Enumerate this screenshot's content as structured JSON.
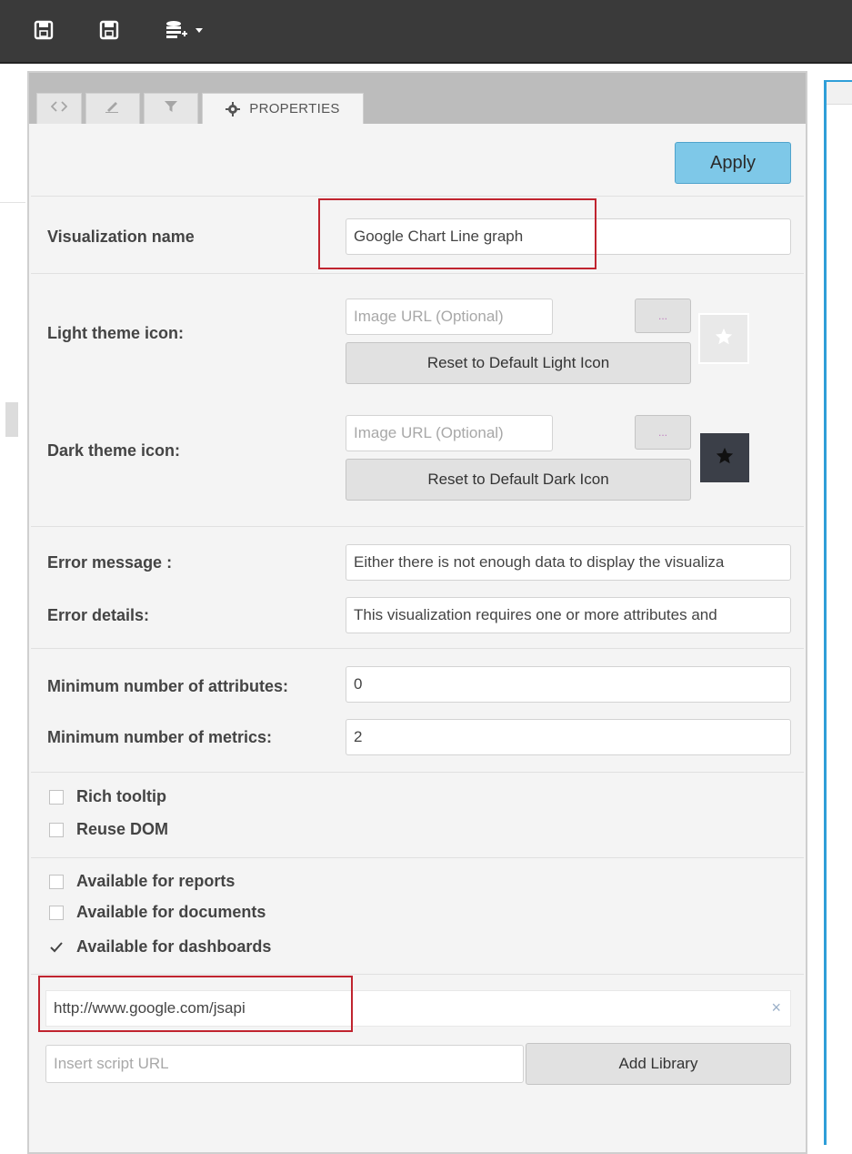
{
  "toolbar": {
    "items": [
      {
        "icon": "save-icon"
      },
      {
        "icon": "save-as-icon"
      },
      {
        "icon": "add-dataset-icon"
      }
    ]
  },
  "tabs": [
    {
      "icon": "code-icon",
      "label": ""
    },
    {
      "icon": "pencil-icon",
      "label": ""
    },
    {
      "icon": "filter-icon",
      "label": ""
    },
    {
      "icon": "gear-icon",
      "label": "PROPERTIES"
    }
  ],
  "apply_label": "Apply",
  "visualization": {
    "label": "Visualization name",
    "value": "Google Chart Line graph"
  },
  "light_icon": {
    "label": "Light theme icon:",
    "placeholder": "Image URL (Optional)",
    "browse_label": "...",
    "reset_label": "Reset to Default Light Icon"
  },
  "dark_icon": {
    "label": "Dark theme icon:",
    "placeholder": "Image URL (Optional)",
    "browse_label": "...",
    "reset_label": "Reset to Default Dark Icon"
  },
  "error_message": {
    "label": "Error message :",
    "value": "Either there is not enough data to display the visualiza"
  },
  "error_details": {
    "label": "Error details:",
    "value": "This visualization requires one or more attributes and"
  },
  "min_attributes": {
    "label": "Minimum number of attributes:",
    "value": "0"
  },
  "min_metrics": {
    "label": "Minimum number of metrics:",
    "value": "2"
  },
  "options": [
    {
      "label": "Rich tooltip",
      "checked": false
    },
    {
      "label": "Reuse DOM",
      "checked": false
    }
  ],
  "availability": [
    {
      "label": "Available for reports",
      "checked": false
    },
    {
      "label": "Available for documents",
      "checked": false
    },
    {
      "label": "Available for dashboards",
      "checked": true
    }
  ],
  "library": {
    "url": "http://www.google.com/jsapi",
    "remove_symbol": "×",
    "placeholder": "Insert script URL",
    "add_label": "Add Library"
  },
  "colors": {
    "accent_blue": "#7ec8e8",
    "highlight_red": "#c0242f",
    "toolbar_bg": "#3a3a3a"
  }
}
